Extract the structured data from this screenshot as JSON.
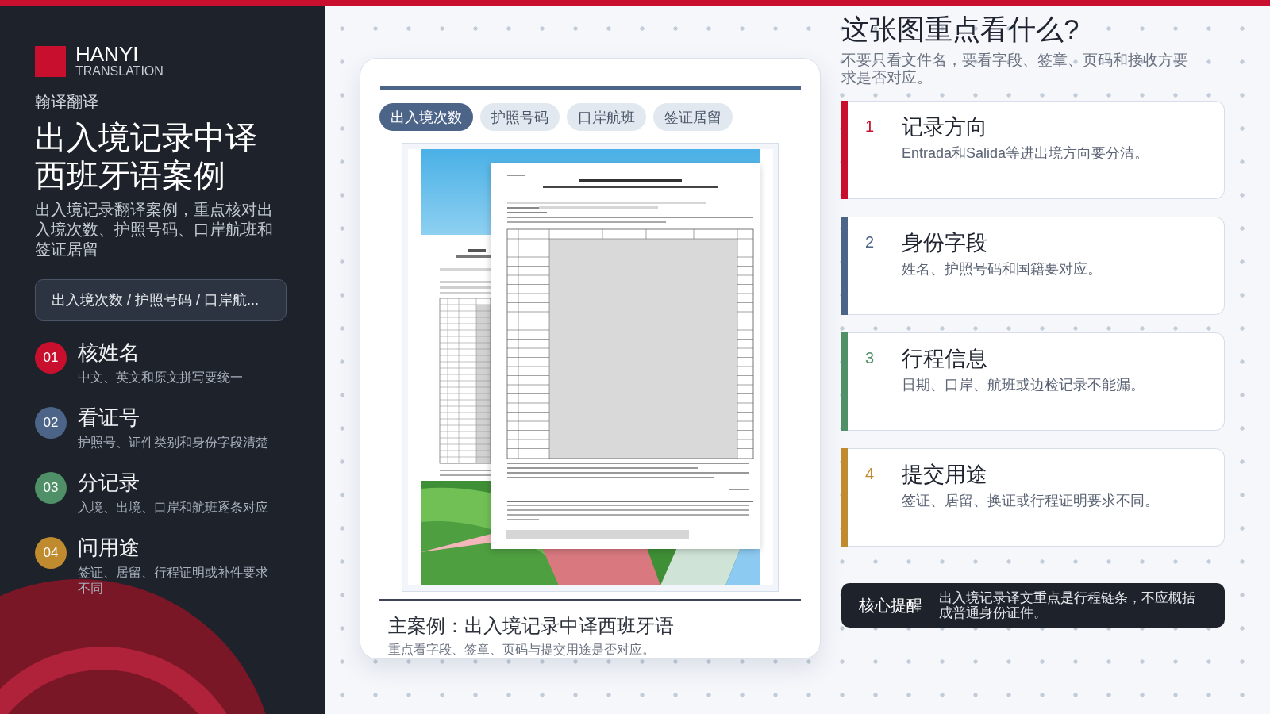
{
  "sidebar": {
    "logo": {
      "name": "HANYI",
      "subtitle": "TRANSLATION"
    },
    "brand": "翰译翻译",
    "title": "出入境记录中译西班牙语案例",
    "description": "出入境记录翻译案例，重点核对出入境次数、护照号码、口岸航班和签证居留",
    "keywords": "出入境次数 / 护照号码 / 口岸航...",
    "steps": [
      {
        "number": "01",
        "title": "核姓名",
        "text": "中文、英文和原文拼写要统一",
        "color": "#c8102e"
      },
      {
        "number": "02",
        "title": "看证号",
        "text": "护照号、证件类别和身份字段清楚",
        "color": "#4c6488"
      },
      {
        "number": "03",
        "title": "分记录",
        "text": "入境、出境、口岸和航班逐条对应",
        "color": "#4f9068"
      },
      {
        "number": "04",
        "title": "问用途",
        "text": "签证、居留、行程证明或补件要求不同",
        "color": "#c08a2f"
      }
    ]
  },
  "case_card": {
    "tabs": [
      {
        "label": "出入境次数",
        "selected": true
      },
      {
        "label": "护照号码",
        "selected": false
      },
      {
        "label": "口岸航班",
        "selected": false
      },
      {
        "label": "签证居留",
        "selected": false
      }
    ],
    "caption_title": "主案例：出入境记录中译西班牙语",
    "caption_text": "重点看字段、签章、页码与提交用途是否对应。"
  },
  "focus": {
    "heading": "这张图重点看什么?",
    "intro": "不要只看文件名，要看字段、签章、页码和接收方要求是否对应。",
    "points": [
      {
        "number": "1",
        "title": "记录方向",
        "text": "Entrada和Salida等进出境方向要分清。",
        "color": "#c8102e"
      },
      {
        "number": "2",
        "title": "身份字段",
        "text": "姓名、护照号码和国籍要对应。",
        "color": "#4c6488"
      },
      {
        "number": "3",
        "title": "行程信息",
        "text": "日期、口岸、航班或边检记录不能漏。",
        "color": "#4f9068"
      },
      {
        "number": "4",
        "title": "提交用途",
        "text": "签证、居留、换证或行程证明要求不同。",
        "color": "#c08a2f"
      }
    ]
  },
  "reminder": {
    "label": "核心提醒",
    "text": "出入境记录译文重点是行程链条，不应概括成普通身份证件。"
  }
}
